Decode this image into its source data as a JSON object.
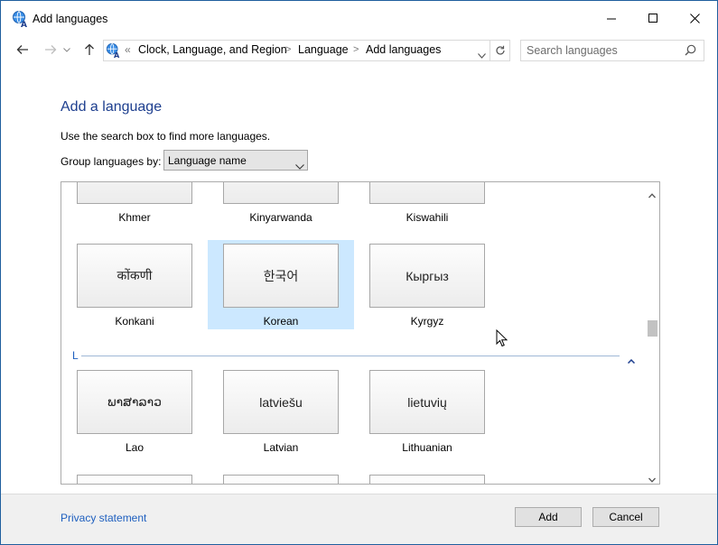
{
  "window": {
    "title": "Add languages"
  },
  "address_bar": {
    "overflow": "«",
    "crumbs": [
      "Clock, Language, and Region",
      "Language",
      "Add languages"
    ],
    "separator": ">"
  },
  "search": {
    "placeholder": "Search languages"
  },
  "content": {
    "heading": "Add a language",
    "description": "Use the search box to find more languages.",
    "group_label": "Group languages by:",
    "group_value": "Language name"
  },
  "languages": {
    "row_top": [
      {
        "native": "",
        "name": "Khmer"
      },
      {
        "native": "",
        "name": "Kinyarwanda"
      },
      {
        "native": "",
        "name": "Kiswahili"
      }
    ],
    "row_k": [
      {
        "native": "कोंकणी",
        "name": "Konkani",
        "selected": false
      },
      {
        "native": "한국어",
        "name": "Korean",
        "selected": true
      },
      {
        "native": "Кыргыз",
        "name": "Kyrgyz",
        "selected": false
      }
    ],
    "section_l": "L",
    "row_l": [
      {
        "native": "ພາສາລາວ",
        "name": "Lao"
      },
      {
        "native": "latviešu",
        "name": "Latvian"
      },
      {
        "native": "lietuvių",
        "name": "Lithuanian"
      }
    ]
  },
  "footer": {
    "privacy": "Privacy statement",
    "add": "Add",
    "cancel": "Cancel"
  },
  "colors": {
    "accent": "#1e5fbf",
    "selection": "#cce8ff",
    "heading": "#1e3f8f"
  }
}
